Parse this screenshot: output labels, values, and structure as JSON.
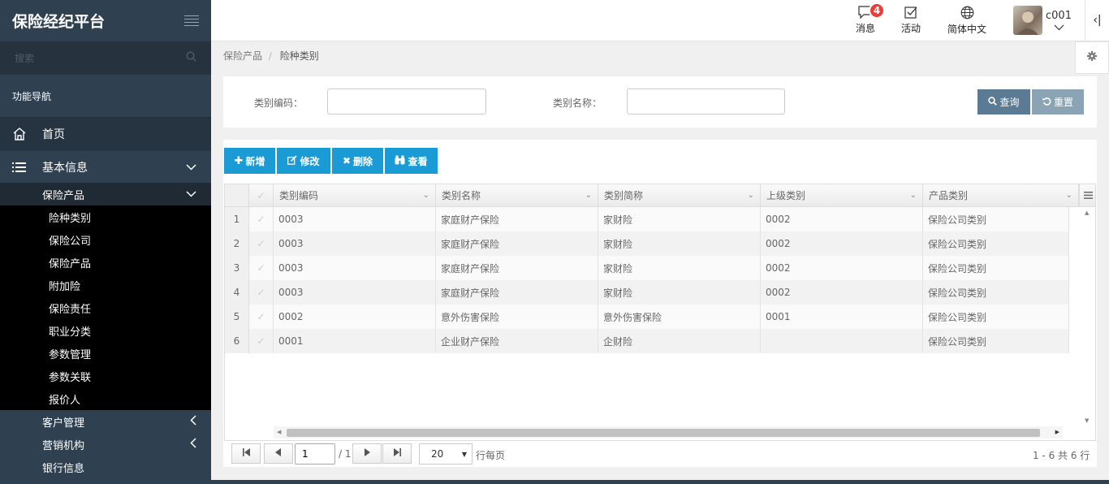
{
  "app": {
    "title": "保险经纪平台"
  },
  "search": {
    "placeholder": "搜索"
  },
  "nav": {
    "title": "功能导航",
    "home": "首页",
    "basic": "基本信息",
    "insurance_products": "保险产品",
    "sub_items": [
      "险种类别",
      "保险公司",
      "保险产品",
      "附加险",
      "保险责任",
      "职业分类",
      "参数管理",
      "参数关联",
      "报价人"
    ],
    "customer": "客户管理",
    "marketing": "营销机构",
    "bank": "银行信息"
  },
  "topbar": {
    "messages": "消息",
    "message_count": "4",
    "activity": "活动",
    "language": "简体中文",
    "user": "c001",
    "collapse": "‹|"
  },
  "breadcrumb": {
    "parent": "保险产品",
    "sep": "/",
    "current": "险种类别"
  },
  "query": {
    "code_label": "类别编码：",
    "name_label": "类别名称：",
    "code_value": "",
    "name_value": "",
    "search_btn": "查询",
    "reset_btn": "重置"
  },
  "toolbar": {
    "add": "新增",
    "edit": "修改",
    "delete": "删除",
    "view": "查看"
  },
  "grid": {
    "headers": [
      "类别编码",
      "类别名称",
      "类别简称",
      "上级类别",
      "产品类别"
    ],
    "rows": [
      {
        "no": "1",
        "code": "0003",
        "name": "家庭财产保险",
        "short": "家财险",
        "parent": "0002",
        "product": "保险公司类别"
      },
      {
        "no": "2",
        "code": "0003",
        "name": "家庭财产保险",
        "short": "家财险",
        "parent": "0002",
        "product": "保险公司类别"
      },
      {
        "no": "3",
        "code": "0003",
        "name": "家庭财产保险",
        "short": "家财险",
        "parent": "0002",
        "product": "保险公司类别"
      },
      {
        "no": "4",
        "code": "0003",
        "name": "家庭财产保险",
        "short": "家财险",
        "parent": "0002",
        "product": "保险公司类别"
      },
      {
        "no": "5",
        "code": "0002",
        "name": "意外伤害保险",
        "short": "意外伤害保险",
        "parent": "0001",
        "product": "保险公司类别"
      },
      {
        "no": "6",
        "code": "0001",
        "name": "企业财产保险",
        "short": "企财险",
        "parent": "",
        "product": "保险公司类别"
      }
    ]
  },
  "pager": {
    "page": "1",
    "of": "/ 1",
    "page_size": "20",
    "per_page_label": "行每页",
    "summary": "1 - 6 共 6 行"
  },
  "colors": {
    "sidebar": "#2f4050",
    "accent": "#1a9bd6",
    "query_btn": "#5b7b94",
    "reset_btn": "#8aa3b5",
    "badge": "#ed3b36"
  }
}
